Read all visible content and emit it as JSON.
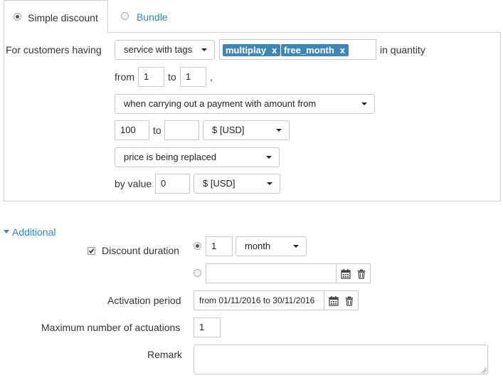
{
  "tabs": {
    "simple_discount": "Simple discount",
    "bundle": "Bundle"
  },
  "condition": {
    "customers_label": "For customers having",
    "service_select": "service with tags",
    "tags": [
      "multiplay",
      "free_month"
    ],
    "tag_remove": "x",
    "in_quantity": "in quantity",
    "from_label": "from",
    "from_value": "1",
    "to_label": "to",
    "to_value": "1",
    "comma": ",",
    "payment_select": "when carrying out a payment with amount from",
    "amount_from": "100",
    "amount_to_label": "to",
    "amount_to": "",
    "amount_currency": "$ [USD]",
    "price_select": "price is being replaced",
    "by_value_label": "by value",
    "by_value": "0",
    "value_currency": "$ [USD]"
  },
  "additional": {
    "toggle_label": "Additional",
    "discount_duration_label": "Discount duration",
    "duration_value": "1",
    "duration_unit": "month",
    "duration_date": "",
    "activation_period_label": "Activation period",
    "activation_period_value": "from 01/11/2016 to 30/11/2016",
    "max_actuations_label": "Maximum number of actuations",
    "max_actuations_value": "1",
    "remark_label": "Remark",
    "remark_value": ""
  }
}
